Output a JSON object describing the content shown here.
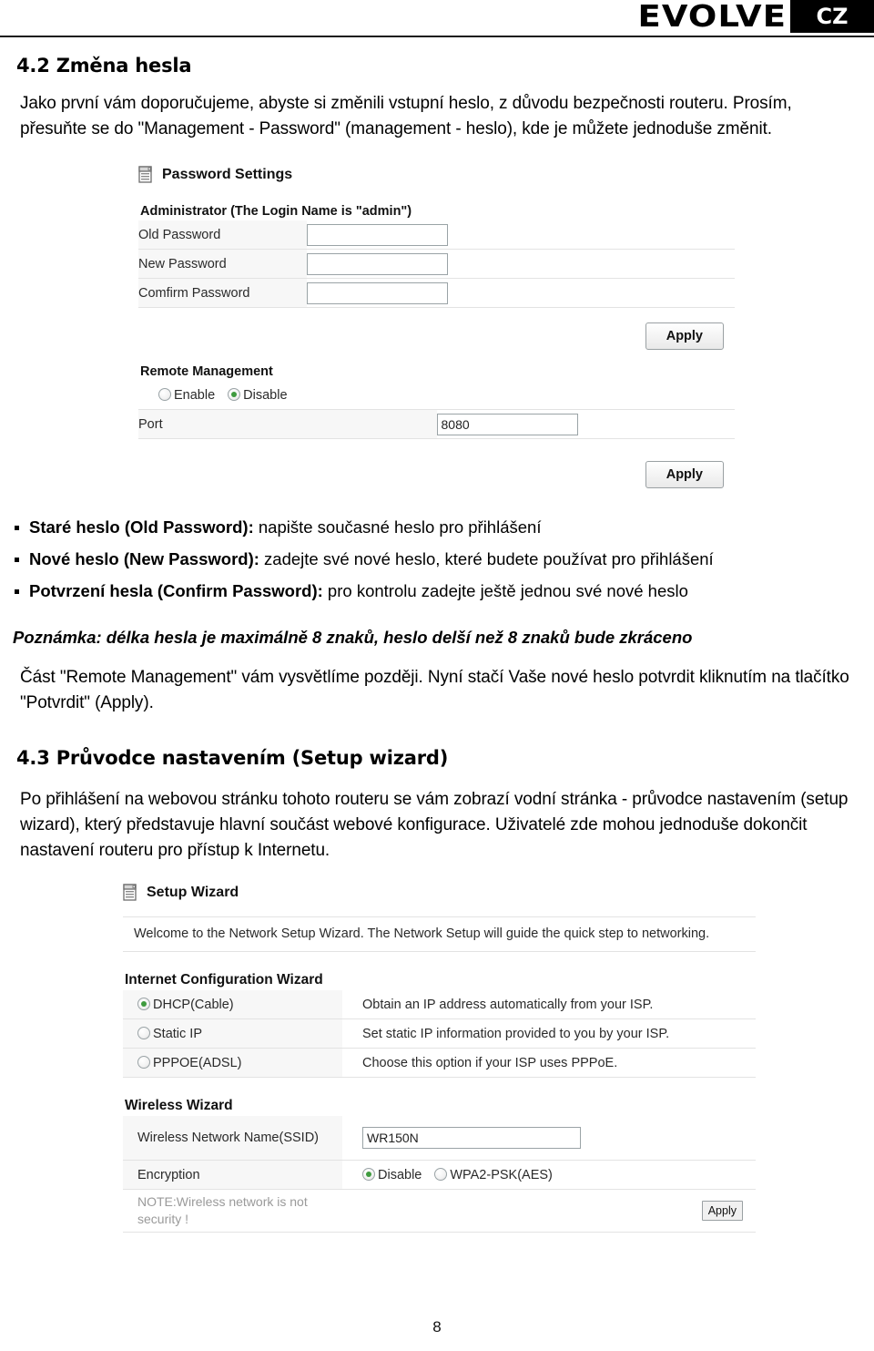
{
  "header": {
    "brand": "EVOLVE",
    "region_badge": "CZ"
  },
  "doc": {
    "section_42_heading": "4.2 Změna hesla",
    "section_42_paragraph": "Jako první vám doporučujeme, abyste si změnili vstupní heslo, z důvodu bezpečnosti routeru. Prosím, přesuňte se do \"Management - Password\" (management - heslo), kde je můžete jednoduše změnit.",
    "bullets": [
      {
        "bold": "Staré heslo (Old Password):",
        "rest": " napište současné heslo pro přihlášení"
      },
      {
        "bold": "Nové heslo (New Password):",
        "rest": " zadejte své nové heslo, které budete používat pro přihlášení"
      },
      {
        "bold": "Potvrzení hesla (Confirm Password):",
        "rest": " pro kontrolu zadejte ještě jednou své nové heslo"
      }
    ],
    "note": "Poznámka: délka hesla je maximálně 8 znaků, heslo delší než 8 znaků bude zkráceno",
    "remote_mgmt_paragraph": "Část \"Remote Management\" vám vysvětlíme později. Nyní stačí Vaše nové heslo potvrdit kliknutím na tlačítko \"Potvrdit\" (Apply).",
    "section_43_heading": "4.3 Průvodce nastavením  (Setup wizard)",
    "section_43_paragraph": "Po přihlášení na webovou stránku tohoto routeru se vám zobrazí vodní stránka - průvodce nastavením (setup wizard), který představuje hlavní součást webové konfigurace. Uživatelé zde mohou jednoduše dokončit nastavení routeru pro přístup k Internetu.",
    "page_number": "8"
  },
  "password_shot": {
    "title": "Password Settings",
    "title_icon": "server-list-icon",
    "admin_label": "Administrator (The Login Name is \"admin\")",
    "rows": [
      {
        "label": "Old Password",
        "value": ""
      },
      {
        "label": "New Password",
        "value": ""
      },
      {
        "label": "Comfirm Password",
        "value": ""
      }
    ],
    "apply_label": "Apply",
    "remote_management": {
      "label": "Remote Management",
      "options": [
        {
          "label": "Enable",
          "selected": false
        },
        {
          "label": "Disable",
          "selected": true
        }
      ],
      "port_label": "Port",
      "port_value": "8080"
    },
    "apply_label_2": "Apply"
  },
  "setup_shot": {
    "title": "Setup Wizard",
    "title_icon": "server-list-icon",
    "welcome_text": "Welcome to the Network Setup Wizard. The Network Setup will guide the quick step to networking.",
    "internet_wizard_label": "Internet Configuration Wizard",
    "internet_options": [
      {
        "label": "DHCP(Cable)",
        "description": "Obtain an IP address automatically from your ISP.",
        "selected": true
      },
      {
        "label": "Static IP",
        "description": "Set static IP information provided to you by your ISP.",
        "selected": false
      },
      {
        "label": "PPPOE(ADSL)",
        "description": "Choose this option if your ISP uses PPPoE.",
        "selected": false
      }
    ],
    "wireless_wizard_label": "Wireless Wizard",
    "ssid_label": "Wireless Network Name(SSID)",
    "ssid_value": "WR150N",
    "encryption_label": "Encryption",
    "encryption_options": [
      {
        "label": "Disable",
        "selected": true
      },
      {
        "label": "WPA2-PSK(AES)",
        "selected": false
      }
    ],
    "security_note": "NOTE:Wireless network is not security !",
    "apply_label": "Apply"
  },
  "colors": {
    "radio_selected": "#3f9b3f",
    "table_row_border": "#e3e3e3",
    "label_cell_bg": "#f7f7f7",
    "badge_bg": "#000000"
  }
}
